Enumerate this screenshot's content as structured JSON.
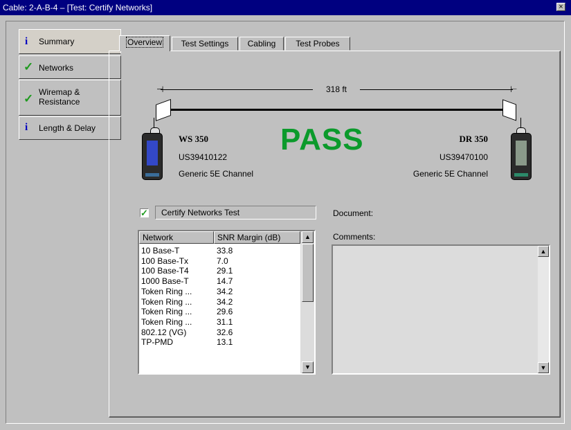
{
  "window": {
    "title": "Cable: 2-A-B-4 – [Test: Certify Networks]",
    "close_glyph": "×"
  },
  "nav": [
    {
      "label": "Summary",
      "icon": "info-icon",
      "glyph": "i"
    },
    {
      "label": "Networks",
      "icon": "check-icon",
      "glyph": "✓"
    },
    {
      "label": "Wiremap &\nResistance",
      "icon": "check-icon",
      "glyph": "✓"
    },
    {
      "label": "Length & Delay",
      "icon": "info-icon",
      "glyph": "i"
    }
  ],
  "tabs": [
    "Overview",
    "Test Settings",
    "Cabling",
    "Test Probes"
  ],
  "cable": {
    "length": "318 ft"
  },
  "result": "PASS",
  "left_device": {
    "model": "WS 350",
    "serial": "US39410122",
    "type": "Generic 5E Channel"
  },
  "right_device": {
    "model": "DR 350",
    "serial": "US39470100",
    "type": "Generic 5E Channel"
  },
  "test_name": "Certify Networks Test",
  "document_label": "Document:",
  "comments_label": "Comments:",
  "table": {
    "headers": [
      "Network",
      "SNR Margin (dB)"
    ],
    "rows": [
      [
        "10 Base-T",
        "33.8"
      ],
      [
        "100 Base-Tx",
        "7.0"
      ],
      [
        "100 Base-T4",
        "29.1"
      ],
      [
        "1000 Base-T",
        "14.7"
      ],
      [
        "Token Ring ...",
        "34.2"
      ],
      [
        "Token Ring ...",
        "34.2"
      ],
      [
        "Token Ring ...",
        "29.6"
      ],
      [
        "Token Ring ...",
        "31.1"
      ],
      [
        "802.12 (VG)",
        "32.6"
      ],
      [
        "TP-PMD",
        "13.1"
      ]
    ]
  },
  "scroll_glyphs": {
    "up": "▲",
    "down": "▼"
  },
  "colors": {
    "titlebar": "#000080",
    "pass": "#0b9a2b",
    "check": "#1f9a1f",
    "info": "#0000c0"
  }
}
